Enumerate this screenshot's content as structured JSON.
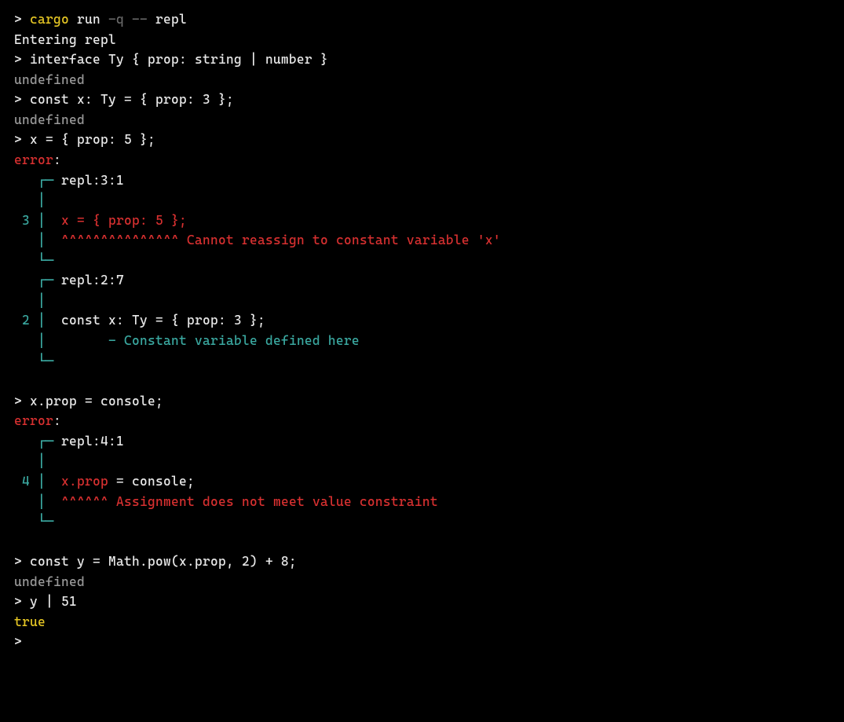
{
  "colors": {
    "bg": "#000000",
    "fg": "#e8e8e8",
    "yellow": "#e5c624",
    "dim": "#6b6b6b",
    "grey": "#9a9a9a",
    "red": "#d73030",
    "cyan": "#3aa8a0"
  },
  "session": {
    "shell_prompt": ">",
    "cmd_cargo": "cargo",
    "cmd_run": "run",
    "cmd_flag_q": "-q",
    "cmd_dashdash": "--",
    "cmd_repl": "repl",
    "entering": "Entering repl",
    "input1": "interface Ty { prop: string | number }",
    "result_undefined": "undefined",
    "input2": "const x: Ty = { prop: 3 };",
    "input3": "x = { prop: 5 };",
    "error_label": "error",
    "colon": ":",
    "err1": {
      "loc1": "repl:3:1",
      "gutter3": "3",
      "code3": "x = { prop: 5 };",
      "carets3": "^^^^^^^^^^^^^^^",
      "msg3": "Cannot reassign to constant variable 'x'",
      "loc2": "repl:2:7",
      "gutter2": "2",
      "code2": "const x: Ty = { prop: 3 };",
      "dash2": "-",
      "msg2": "Constant variable defined here"
    },
    "input4": "x.prop = console;",
    "err2": {
      "loc": "repl:4:1",
      "gutter": "4",
      "code_left": "x.prop",
      "code_right": " = console;",
      "carets": "^^^^^^",
      "msg": "Assignment does not meet value constraint"
    },
    "input5": "const y = Math.pow(x.prop, 2) + 8;",
    "input6": "y | 51",
    "result_true": "true",
    "box": {
      "top_corner": "┌─",
      "side": "│",
      "bot_corner": "└─"
    }
  }
}
